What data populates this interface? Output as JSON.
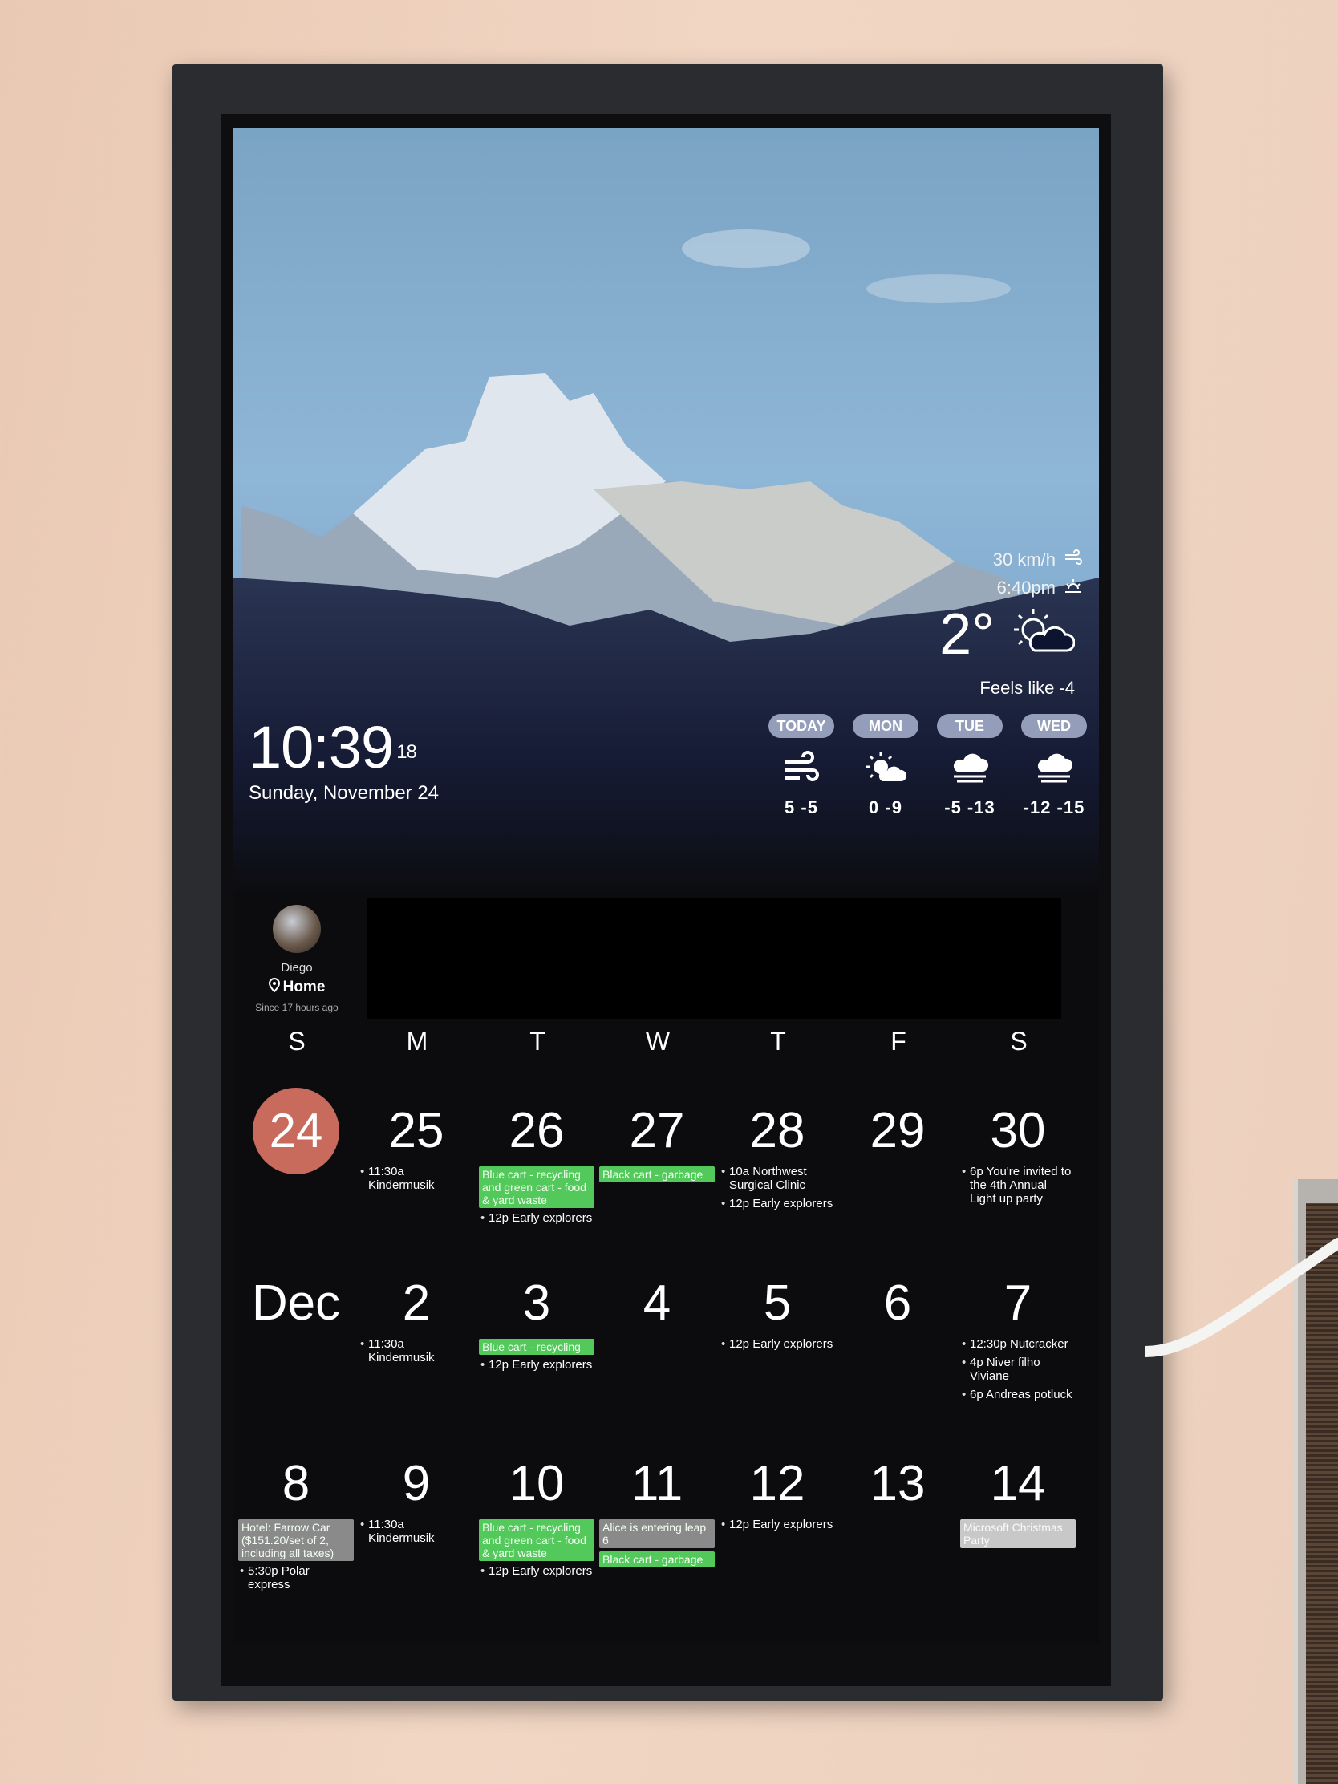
{
  "weather": {
    "wind": "30 km/h",
    "sunset": "6:40pm",
    "temperature": "2°",
    "feels_like": "Feels like -4",
    "forecast": [
      {
        "label": "TODAY",
        "icon": "wind-icon",
        "hilo": "5  -5"
      },
      {
        "label": "MON",
        "icon": "partly-sunny-icon",
        "hilo": "0  -9"
      },
      {
        "label": "TUE",
        "icon": "fog-cloud-icon",
        "hilo": "-5  -13"
      },
      {
        "label": "WED",
        "icon": "fog-cloud-icon",
        "hilo": "-12  -15"
      }
    ]
  },
  "clock": {
    "time": "10:39",
    "seconds": "18",
    "date": "Sunday, November 24"
  },
  "presence": {
    "name": "Diego",
    "location": "Home",
    "since": "Since 17 hours ago"
  },
  "calendar": {
    "weekdays": [
      "S",
      "M",
      "T",
      "W",
      "T",
      "F",
      "S"
    ],
    "week1": {
      "days": [
        "24",
        "25",
        "26",
        "27",
        "28",
        "29",
        "30"
      ],
      "mon_event": "11:30a Kindermusik",
      "tue_tag": "Blue cart - recycling and green cart - food & yard waste",
      "tue_event": "12p Early explorers",
      "wed_tag": "Black cart - garbage",
      "thu_event1": "10a Northwest Surgical Clinic",
      "thu_event2": "12p Early explorers",
      "sat_event": "6p You're invited to the 4th Annual Light up party"
    },
    "week2": {
      "days": [
        "Dec",
        "2",
        "3",
        "4",
        "5",
        "6",
        "7"
      ],
      "mon_event": "11:30a Kindermusik",
      "tue_tag": "Blue cart - recycling",
      "tue_event": "12p Early explorers",
      "thu_event": "12p Early explorers",
      "sat_event1": "12:30p Nutcracker",
      "sat_event2": "4p Niver filho Viviane",
      "sat_event3": "6p Andreas potluck"
    },
    "week3": {
      "days": [
        "8",
        "9",
        "10",
        "11",
        "12",
        "13",
        "14"
      ],
      "sun_tag": "Hotel: Farrow Car ($151.20/set of 2, including all taxes)",
      "sun_event": "5:30p Polar express",
      "mon_event": "11:30a Kindermusik",
      "tue_tag": "Blue cart - recycling and green cart - food & yard waste",
      "tue_event": "12p Early explorers",
      "wed_tag1": "Alice is entering leap 6",
      "wed_tag2": "Black cart - garbage",
      "thu_event": "12p Early explorers",
      "sat_tag": "Microsoft Christmas Party"
    }
  },
  "colors": {
    "today_circle": "#c86a5c",
    "event_green": "#52c95a",
    "pill": "#bec8e6"
  }
}
